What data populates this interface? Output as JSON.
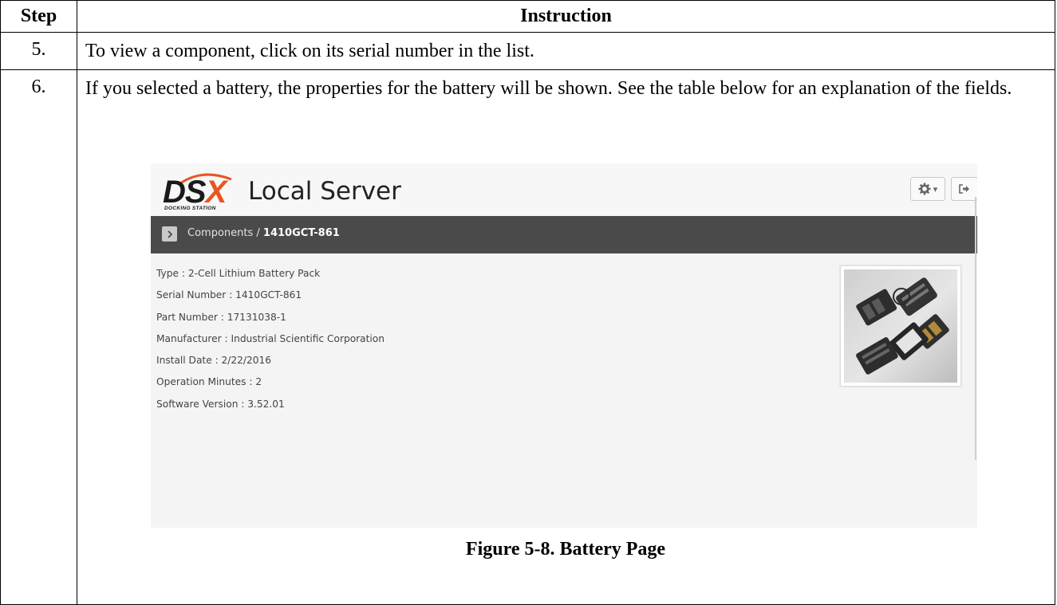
{
  "table": {
    "headers": {
      "step": "Step",
      "instruction": "Instruction"
    },
    "rows": [
      {
        "step": "5.",
        "text": "To view a component, click on its serial number in the list."
      },
      {
        "step": "6.",
        "text": "If you selected a battery, the properties for the battery will be shown. See the table below for an explanation of the fields."
      }
    ]
  },
  "screenshot": {
    "logo": {
      "brand_main": "DS",
      "brand_x": "X",
      "brand_sub": "DOCKING STATION",
      "title": "Local Server"
    },
    "toolbar": {
      "settings_icon": "gear-icon",
      "settings_caret": "▾",
      "logout_icon": "logout-icon",
      "menu_icon": "hamburger-menu-icon"
    },
    "breadcrumb": {
      "parent": "Components /",
      "current": "1410GCT-861"
    },
    "properties": [
      "Type : 2-Cell Lithium Battery Pack",
      "Serial Number : 1410GCT-861",
      "Part Number : 17131038-1",
      "Manufacturer : Industrial Scientific Corporation",
      "Install Date : 2/22/2016",
      "Operation Minutes : 2",
      "Software Version : 3.52.01"
    ],
    "colors": {
      "accent": "#e8561f",
      "breadcrumb_bg": "#4a4a4a",
      "panel_bg": "#f4f4f4"
    }
  },
  "caption": "Figure 5-8.  Battery Page"
}
